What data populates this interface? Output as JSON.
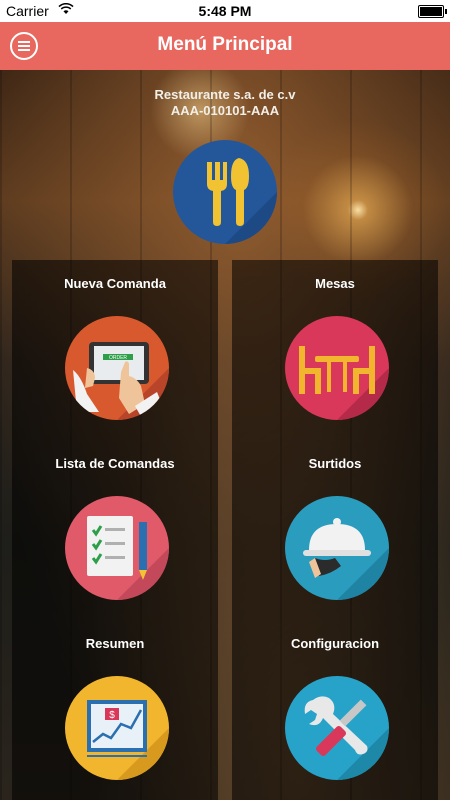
{
  "status_bar": {
    "carrier": "Carrier",
    "time": "5:48 PM"
  },
  "header": {
    "title": "Menú Principal"
  },
  "company": {
    "name": "Restaurante s.a. de c.v",
    "rfc": "AAA-010101-AAA"
  },
  "tiles": [
    {
      "label": "Nueva Comanda",
      "icon": "tablet-order-icon",
      "color": "#d9592f"
    },
    {
      "label": "Mesas",
      "icon": "dining-table-icon",
      "color": "#d9385a"
    },
    {
      "label": "Lista de Comandas",
      "icon": "checklist-icon",
      "color": "#e05a6a"
    },
    {
      "label": "Surtidos",
      "icon": "food-cloche-icon",
      "color": "#2a9dbf"
    },
    {
      "label": "Resumen",
      "icon": "summary-chart-icon",
      "color": "#f1b62d"
    },
    {
      "label": "Configuracion",
      "icon": "wrench-screwdriver-icon",
      "color": "#27a3c9"
    }
  ],
  "tablet_text": "ORDER",
  "colors": {
    "header": "#e8675f",
    "logo": "#24579a",
    "cutlery": "#f1c232"
  }
}
